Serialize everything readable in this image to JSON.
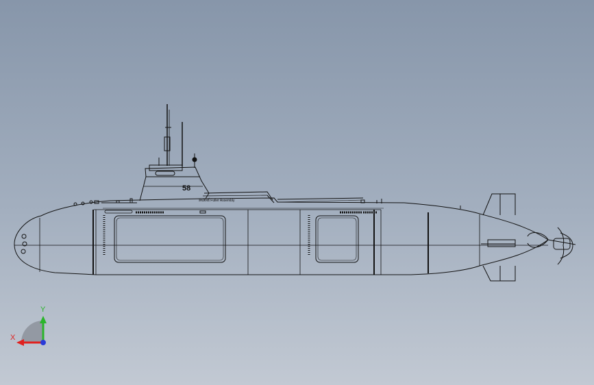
{
  "view": {
    "background_top": "#8796aa",
    "background_bottom": "#c2c9d3",
    "line_color": "#111111"
  },
  "model": {
    "hull_number": "58",
    "hull_caption": "ลิขสิทธิ์ Fuller Assembly"
  },
  "triad": {
    "x_label": "X",
    "y_label": "Y",
    "x_color": "#e0211f",
    "y_color": "#2bb52b",
    "z_color": "#2a3bd8"
  }
}
